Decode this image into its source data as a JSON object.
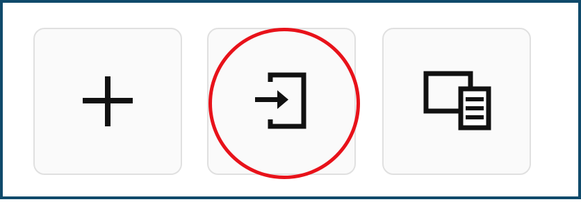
{
  "toolbar": {
    "buttons": [
      {
        "id": "add",
        "icon": "plus-icon",
        "label": ""
      },
      {
        "id": "import",
        "icon": "sign-in-icon",
        "label": ""
      },
      {
        "id": "copy",
        "icon": "window-list-icon",
        "label": ""
      }
    ]
  },
  "annotation": {
    "highlight_color": "#e8121a",
    "highlighted_button": "import"
  },
  "colors": {
    "frame_border": "#0f4a6b",
    "button_border": "#e0e0e0",
    "icon": "#111111"
  }
}
